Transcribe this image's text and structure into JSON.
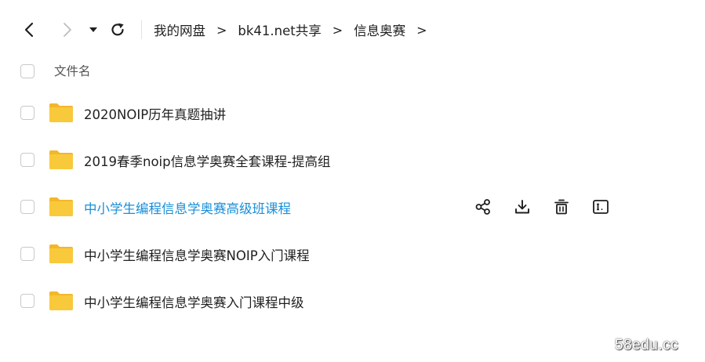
{
  "toolbar": {
    "icons": {
      "back": "chevron-left-icon",
      "forward": "chevron-right-icon",
      "dropdown": "caret-down-icon",
      "refresh": "refresh-icon"
    }
  },
  "breadcrumb": {
    "items": [
      "我的网盘",
      "bk41.net共享",
      "信息奥赛"
    ],
    "separator": ">"
  },
  "list": {
    "column_name": "文件名",
    "rows": [
      {
        "name": "2020NOIP历年真题抽讲",
        "type": "folder"
      },
      {
        "name": "2019春季noip信息学奥赛全套课程-提高组",
        "type": "folder"
      },
      {
        "name": "中小学生编程信息学奥赛高级班课程",
        "type": "folder"
      },
      {
        "name": "中小学生编程信息学奥赛NOIP入门课程",
        "type": "folder"
      },
      {
        "name": "中小学生编程信息学奥赛入门课程中级",
        "type": "folder"
      }
    ],
    "hovered_row": 2,
    "row_actions": [
      "share-icon",
      "download-icon",
      "trash-icon",
      "rename-icon"
    ]
  },
  "colors": {
    "folder": "#f9c93c",
    "folder_tab": "#f2b72a",
    "link_hover": "#1a8fd8",
    "text": "#1f1f1f",
    "muted": "#555555"
  },
  "watermark": "58edu.cc"
}
